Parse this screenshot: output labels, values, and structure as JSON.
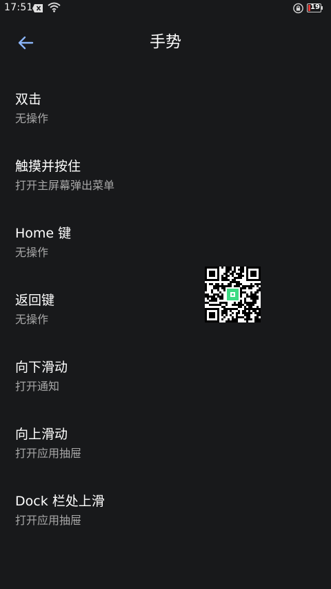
{
  "status_bar": {
    "time": "17:51",
    "battery_level": "19",
    "icons": [
      "notification-x-icon",
      "wifi-icon",
      "lock-icon",
      "battery-icon"
    ]
  },
  "header": {
    "title": "手势",
    "back_icon": "arrow-left-icon"
  },
  "gestures": [
    {
      "title": "双击",
      "value": "无操作"
    },
    {
      "title": "触摸并按住",
      "value": "打开主屏幕弹出菜单"
    },
    {
      "title": "Home 键",
      "value": "无操作"
    },
    {
      "title": "返回键",
      "value": "无操作"
    },
    {
      "title": "向下滑动",
      "value": "打开通知"
    },
    {
      "title": "向上滑动",
      "value": "打开应用抽屉"
    },
    {
      "title": "Dock 栏处上滑",
      "value": "打开应用抽屉"
    }
  ],
  "colors": {
    "background": "#18191b",
    "accent": "#8ab4f8",
    "subtitle": "#a8a8a8",
    "qr_center": "#3ddc84"
  }
}
